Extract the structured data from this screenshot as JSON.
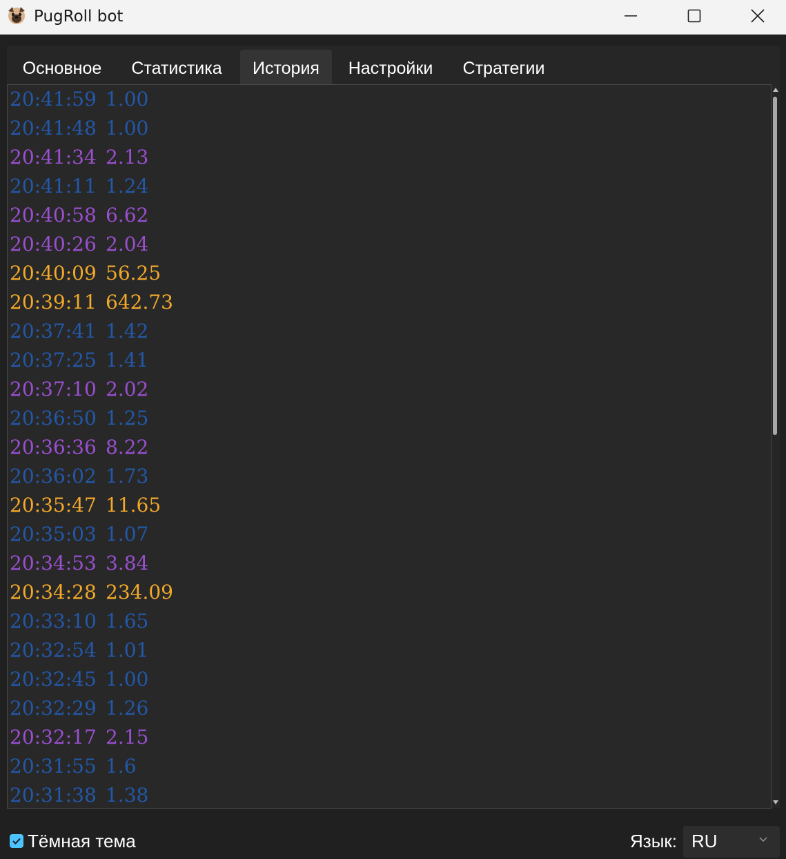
{
  "window": {
    "title": "PugRoll bot"
  },
  "tabs": [
    {
      "label": "Основное"
    },
    {
      "label": "Статистика"
    },
    {
      "label": "История"
    },
    {
      "label": "Настройки"
    },
    {
      "label": "Стратегии"
    }
  ],
  "active_tab": "История",
  "history": [
    {
      "time": "20:41:59",
      "value": "1.00",
      "level": "low"
    },
    {
      "time": "20:41:48",
      "value": "1.00",
      "level": "low"
    },
    {
      "time": "20:41:34",
      "value": "2.13",
      "level": "mid"
    },
    {
      "time": "20:41:11",
      "value": "1.24",
      "level": "low"
    },
    {
      "time": "20:40:58",
      "value": "6.62",
      "level": "mid"
    },
    {
      "time": "20:40:26",
      "value": "2.04",
      "level": "mid"
    },
    {
      "time": "20:40:09",
      "value": "56.25",
      "level": "high"
    },
    {
      "time": "20:39:11",
      "value": "642.73",
      "level": "high"
    },
    {
      "time": "20:37:41",
      "value": "1.42",
      "level": "low"
    },
    {
      "time": "20:37:25",
      "value": "1.41",
      "level": "low"
    },
    {
      "time": "20:37:10",
      "value": "2.02",
      "level": "mid"
    },
    {
      "time": "20:36:50",
      "value": "1.25",
      "level": "low"
    },
    {
      "time": "20:36:36",
      "value": "8.22",
      "level": "mid"
    },
    {
      "time": "20:36:02",
      "value": "1.73",
      "level": "low"
    },
    {
      "time": "20:35:47",
      "value": "11.65",
      "level": "high"
    },
    {
      "time": "20:35:03",
      "value": "1.07",
      "level": "low"
    },
    {
      "time": "20:34:53",
      "value": "3.84",
      "level": "mid"
    },
    {
      "time": "20:34:28",
      "value": "234.09",
      "level": "high"
    },
    {
      "time": "20:33:10",
      "value": "1.65",
      "level": "low"
    },
    {
      "time": "20:32:54",
      "value": "1.01",
      "level": "low"
    },
    {
      "time": "20:32:45",
      "value": "1.00",
      "level": "low"
    },
    {
      "time": "20:32:29",
      "value": "1.26",
      "level": "low"
    },
    {
      "time": "20:32:17",
      "value": "2.15",
      "level": "mid"
    },
    {
      "time": "20:31:55",
      "value": "1.6",
      "level": "low"
    },
    {
      "time": "20:31:38",
      "value": "1.38",
      "level": "low"
    }
  ],
  "colors": {
    "low": "#2358a8",
    "mid": "#9a4fcf",
    "high": "#f2a92a",
    "accent": "#4cc2ff"
  },
  "footer": {
    "dark_theme_label": "Тёмная тема",
    "dark_theme_checked": true,
    "language_label": "Язык:",
    "language_value": "RU"
  },
  "icons": {
    "app": "pug-icon",
    "minimize": "minimize-icon",
    "maximize": "maximize-icon",
    "close": "close-icon",
    "dropdown": "chevron-down-icon",
    "check": "checkmark-icon"
  }
}
